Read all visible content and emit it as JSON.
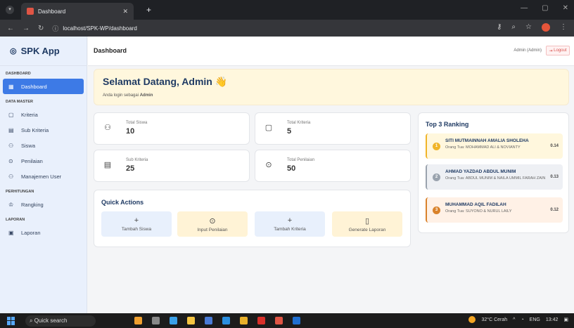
{
  "browser": {
    "tab_title": "Dashboard",
    "url": "localhost/SPK-WP/dashboard"
  },
  "app": {
    "brand": "SPK App",
    "page_title": "Dashboard",
    "user_label": "Admin (Admin)",
    "logout_label": "Logout"
  },
  "sidebar": {
    "sections": [
      {
        "title": "DASHBOARD",
        "items": [
          {
            "label": "Dashboard",
            "icon": "grid-icon",
            "active": true
          }
        ]
      },
      {
        "title": "DATA MASTER",
        "items": [
          {
            "label": "Kriteria",
            "icon": "clipboard-icon"
          },
          {
            "label": "Sub Kriteria",
            "icon": "list-icon"
          },
          {
            "label": "Siswa",
            "icon": "users-icon"
          },
          {
            "label": "Penilaian",
            "icon": "check-circle-icon"
          },
          {
            "label": "Manajemen User",
            "icon": "user-gear-icon"
          }
        ]
      },
      {
        "title": "PERHITUNGAN",
        "items": [
          {
            "label": "Rangking",
            "icon": "trophy-icon"
          }
        ]
      },
      {
        "title": "LAPORAN",
        "items": [
          {
            "label": "Laporan",
            "icon": "report-icon"
          }
        ]
      }
    ]
  },
  "welcome": {
    "title": "Selamat Datang, Admin 👋",
    "subtitle_prefix": "Anda login sebagai ",
    "subtitle_user": "Admin"
  },
  "stats": [
    {
      "label": "Total Siswa",
      "value": "10",
      "icon": "users-icon"
    },
    {
      "label": "Total Kriteria",
      "value": "5",
      "icon": "clipboard-icon"
    },
    {
      "label": "Sub Kriteria",
      "value": "25",
      "icon": "list-icon"
    },
    {
      "label": "Total Penilaian",
      "value": "50",
      "icon": "check-circle-icon"
    }
  ],
  "quick_actions": {
    "title": "Quick Actions",
    "buttons": [
      {
        "label": "Tambah Siswa",
        "icon": "plus-icon"
      },
      {
        "label": "Input Penilaian",
        "icon": "check-circle-icon"
      },
      {
        "label": "Tambah Kriteria",
        "icon": "plus-icon"
      },
      {
        "label": "Generate Laporan",
        "icon": "file-icon"
      }
    ]
  },
  "ranking": {
    "title": "Top 3 Ranking",
    "items": [
      {
        "rank": "1",
        "name": "SITI MUTMAINNAH AMALIA SHOLEHA",
        "parent": "Orang Tua: MOHAMMAD ALI & NOVIANTY",
        "score": "0.14"
      },
      {
        "rank": "2",
        "name": "AHMAD YAZDAD ABDUL MUNIM",
        "parent": "Orang Tua: ABDUL MUNIM & NAILA UMMIL FARAH ZAIN",
        "score": "0.13"
      },
      {
        "rank": "3",
        "name": "MUHAMMAD AQIL FADILAH",
        "parent": "Orang Tua: SUYONO & NURUL LAILY",
        "score": "0.12"
      }
    ]
  },
  "taskbar": {
    "search_label": "Quick search",
    "weather": "32°C Cerah",
    "lang": "ENG",
    "time": "13:42"
  }
}
